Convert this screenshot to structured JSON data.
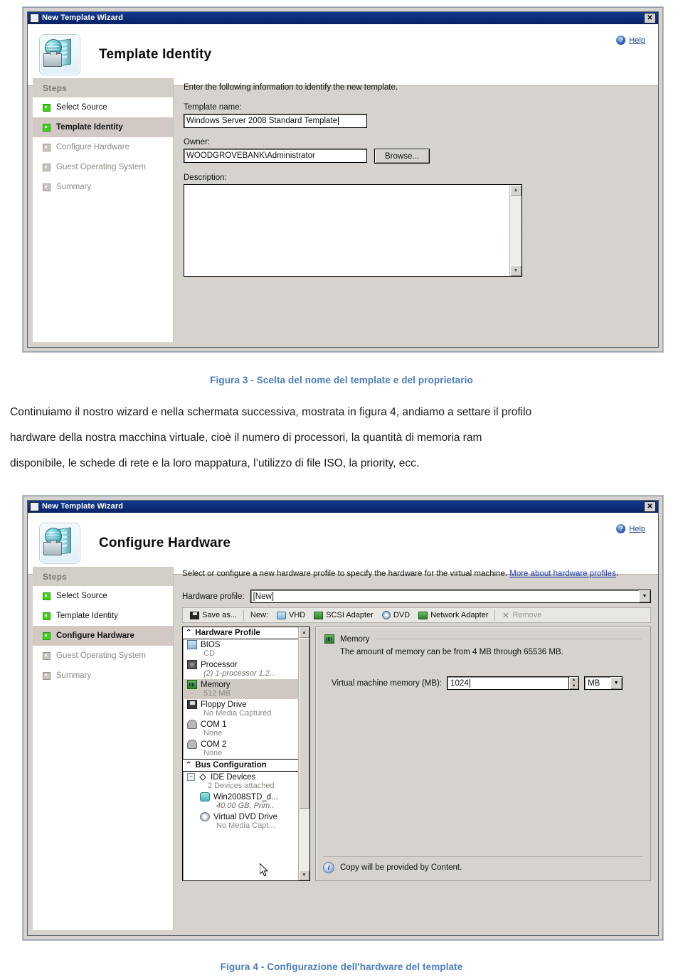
{
  "figure3": {
    "window_title": "New Template Wizard",
    "close_label": "✕",
    "header_title": "Template Identity",
    "help_label": "Help",
    "help_icon_glyph": "?",
    "steps_header": "Steps",
    "steps": [
      {
        "label": "Select Source",
        "state": "done"
      },
      {
        "label": "Template Identity",
        "state": "active"
      },
      {
        "label": "Configure Hardware",
        "state": "todo"
      },
      {
        "label": "Guest Operating System",
        "state": "todo"
      },
      {
        "label": "Summary",
        "state": "todo"
      }
    ],
    "intro": "Enter the following information to identify the new template.",
    "template_name_label": "Template name:",
    "template_name_value": "Windows Server 2008 Standard Template",
    "owner_label": "Owner:",
    "owner_value": "WOODGROVEBANK\\Administrator",
    "browse_label": "Browse...",
    "description_label": "Description:",
    "description_value": "",
    "scroll_up_glyph": "▲",
    "scroll_down_glyph": "▼"
  },
  "caption3": "Figura 3 - Scelta del nome del template e del proprietario",
  "body": {
    "line1": "Continuiamo il nostro wizard e nella schermata successiva, mostrata in figura 4, andiamo a settare il profilo",
    "line2": "hardware della nostra macchina virtuale, cioè il numero di processori, la quantità di memoria ram",
    "line3": "disponibile, le schede di rete e la loro mappatura, l’utilizzo di file ISO, la priority, ecc."
  },
  "figure4": {
    "window_title": "New Template Wizard",
    "close_label": "✕",
    "header_title": "Configure Hardware",
    "help_label": "Help",
    "help_icon_glyph": "?",
    "steps_header": "Steps",
    "steps": [
      {
        "label": "Select Source",
        "state": "done"
      },
      {
        "label": "Template Identity",
        "state": "done"
      },
      {
        "label": "Configure Hardware",
        "state": "active"
      },
      {
        "label": "Guest Operating System",
        "state": "todo"
      },
      {
        "label": "Summary",
        "state": "todo"
      }
    ],
    "intro_text": "Select or configure a new hardware profile to specify the hardware for the virtual machine. ",
    "intro_link": "More about hardware profiles",
    "intro_link_tail": ".",
    "hardware_profile_label": "Hardware profile:",
    "hardware_profile_value": "[New]",
    "dropdown_glyph": "▼",
    "toolbar": {
      "save_as": "Save as...",
      "new_label": "New:",
      "vhd": "VHD",
      "scsi": "SCSI Adapter",
      "dvd": "DVD",
      "network_adapter": "Network Adapter",
      "remove": "Remove",
      "remove_glyph": "✕"
    },
    "tree": {
      "group1": "Hardware Profile",
      "group2": "Bus Configuration",
      "collapse_glyph": "⌃",
      "scroll_up_glyph": "▲",
      "scroll_down_glyph": "▼",
      "nodes": [
        {
          "label": "BIOS",
          "sub": "CD",
          "icon": "bios-icon",
          "selected": false,
          "indent": false,
          "italic": false
        },
        {
          "label": "Processor",
          "sub": "(2) 1-processor 1.2...",
          "icon": "processor-icon",
          "selected": false,
          "indent": false,
          "italic": true
        },
        {
          "label": "Memory",
          "sub": "512 MB",
          "icon": "memory-icon",
          "selected": true,
          "indent": false,
          "italic": false
        },
        {
          "label": "Floppy Drive",
          "sub": "No Media Captured",
          "icon": "floppy-icon",
          "selected": false,
          "indent": false,
          "italic": false
        },
        {
          "label": "COM 1",
          "sub": "None",
          "icon": "com-port-icon",
          "selected": false,
          "indent": false,
          "italic": false
        },
        {
          "label": "COM 2",
          "sub": "None",
          "icon": "com-port-icon",
          "selected": false,
          "indent": false,
          "italic": false
        }
      ],
      "bus_nodes": [
        {
          "label": "IDE Devices",
          "sub": "2 Devices attached",
          "icon": "ide-devices-icon",
          "selected": false,
          "indent": false,
          "italic": false,
          "expander": "−"
        },
        {
          "label": "Win2008STD_d...",
          "sub": "40.00 GB, Prim..",
          "icon": "virtual-disk-icon",
          "selected": false,
          "indent": true,
          "italic": true
        },
        {
          "label": "Virtual DVD Drive",
          "sub": "No Media Capt...",
          "icon": "dvd-drive-icon",
          "selected": false,
          "indent": true,
          "italic": false
        }
      ]
    },
    "detail": {
      "section_title": "Memory",
      "section_text": "The amount of memory can be from 4 MB through 65536 MB.",
      "memory_label": "Virtual machine memory (MB):",
      "memory_value": "1024",
      "unit_value": "MB",
      "unit_arrow": "▼",
      "spin_up": "▲",
      "spin_down": "▼",
      "footer_text": "Copy will be provided by Content.",
      "footer_icon_glyph": "i"
    }
  },
  "caption4": "Figura 4 - Configurazione dell'hardware del template",
  "colors": {
    "caption_blue": "#4a7ebb",
    "titlebar_blue": "#0a2a75",
    "dialog_face": "#d6d3ce",
    "step_active": "#d2c9c4",
    "link_blue": "#1c39bb",
    "done_green": "#3dd413"
  }
}
